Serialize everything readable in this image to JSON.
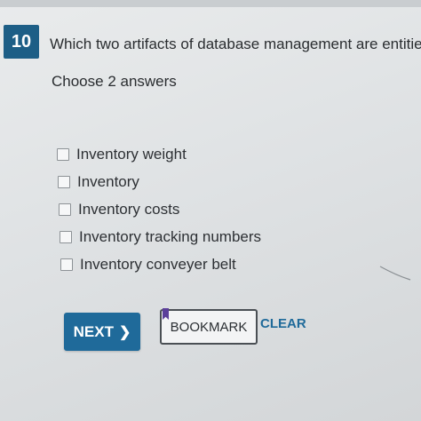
{
  "question": {
    "number": "10",
    "text": "Which two artifacts of database management are entities?",
    "instruction": "Choose 2 answers"
  },
  "answers": [
    {
      "label": "Inventory weight",
      "checked": false
    },
    {
      "label": "Inventory",
      "checked": false
    },
    {
      "label": "Inventory costs",
      "checked": false
    },
    {
      "label": "Inventory tracking numbers",
      "checked": false
    },
    {
      "label": "Inventory conveyer belt",
      "checked": false
    }
  ],
  "buttons": {
    "next_label": "NEXT",
    "next_icon": "chevron-right-icon",
    "bookmark_label": "BOOKMARK",
    "bookmark_icon": "bookmark-flag-icon",
    "clear_label": "CLEAR"
  },
  "colors": {
    "primary": "#1f6a9a",
    "question_badge": "#1d5e86",
    "bookmark_flag": "#5b3f9a"
  }
}
